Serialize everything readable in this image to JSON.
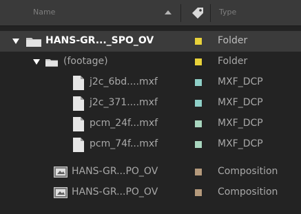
{
  "header": {
    "name_label": "Name",
    "type_label": "Type",
    "sort_icon": "triangle-up-icon",
    "label_icon": "tag-icon"
  },
  "colors": {
    "folder_label": "#e8d23a",
    "mxf_label": "#8fd0c8",
    "pcm_label": "#a9d6bf",
    "comp_label": "#b59a7c",
    "selected_row": "#3b3b3b"
  },
  "items": [
    {
      "name": "HANS-GR..._SPO_OV",
      "type": "Folder",
      "icon": "folder-icon",
      "expanded": true
    },
    {
      "name": "(footage)",
      "type": "Folder",
      "icon": "folder-icon",
      "expanded": true
    },
    {
      "name": "j2c_6bd....mxf",
      "type": "MXF_DCP",
      "icon": "file-icon"
    },
    {
      "name": "j2c_371....mxf",
      "type": "MXF_DCP",
      "icon": "file-icon"
    },
    {
      "name": "pcm_24f...mxf",
      "type": "MXF_DCP",
      "icon": "file-icon"
    },
    {
      "name": "pcm_74f...mxf",
      "type": "MXF_DCP",
      "icon": "file-icon"
    },
    {
      "name": "HANS-GR...PO_OV",
      "type": "Composition",
      "icon": "composition-icon"
    },
    {
      "name": "HANS-GR...PO_OV",
      "type": "Composition",
      "icon": "composition-icon"
    }
  ]
}
